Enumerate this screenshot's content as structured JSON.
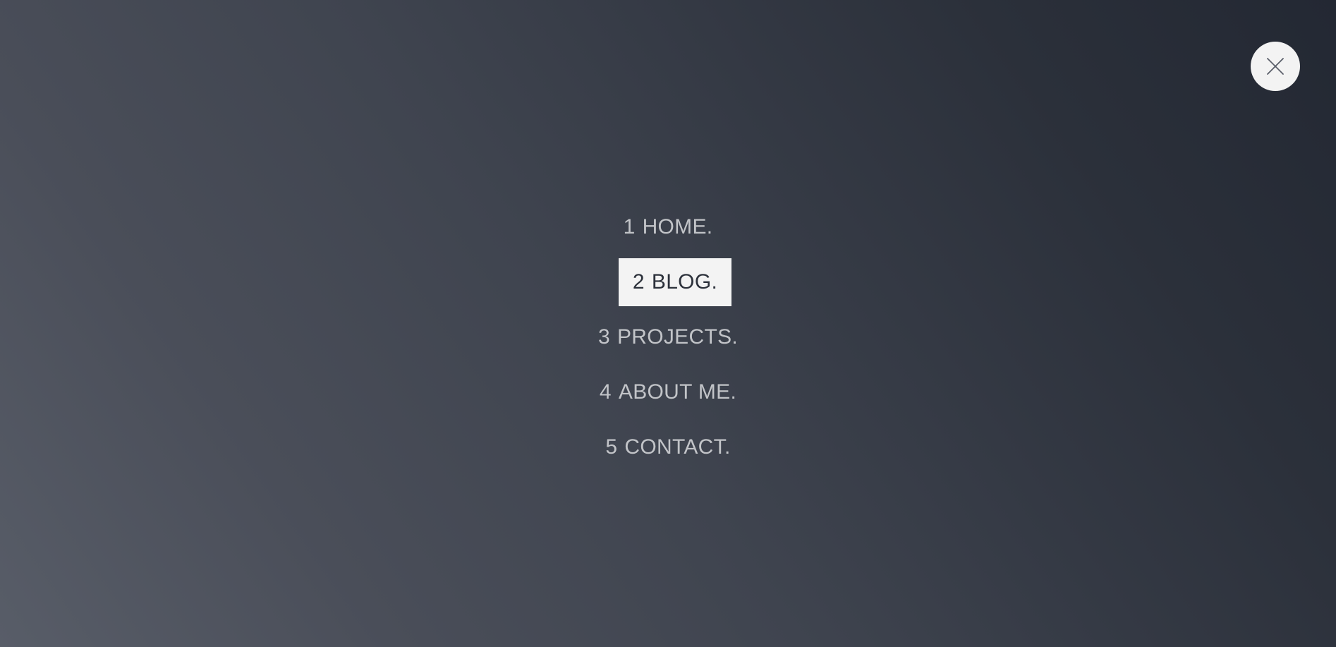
{
  "close": {
    "icon": "close-icon"
  },
  "nav": {
    "items": [
      {
        "number": "1",
        "label": "HOME.",
        "active": false
      },
      {
        "number": "2",
        "label": "BLOG.",
        "active": true
      },
      {
        "number": "3",
        "label": "PROJECTS.",
        "active": false
      },
      {
        "number": "4",
        "label": "ABOUT ME.",
        "active": false
      },
      {
        "number": "5",
        "label": "CONTACT.",
        "active": false
      }
    ]
  },
  "colors": {
    "background_light": "#585d68",
    "background_dark": "#232833",
    "menu_text": "#c2c4c8",
    "active_bg": "#f3f3f3",
    "active_text": "#2c313b"
  }
}
